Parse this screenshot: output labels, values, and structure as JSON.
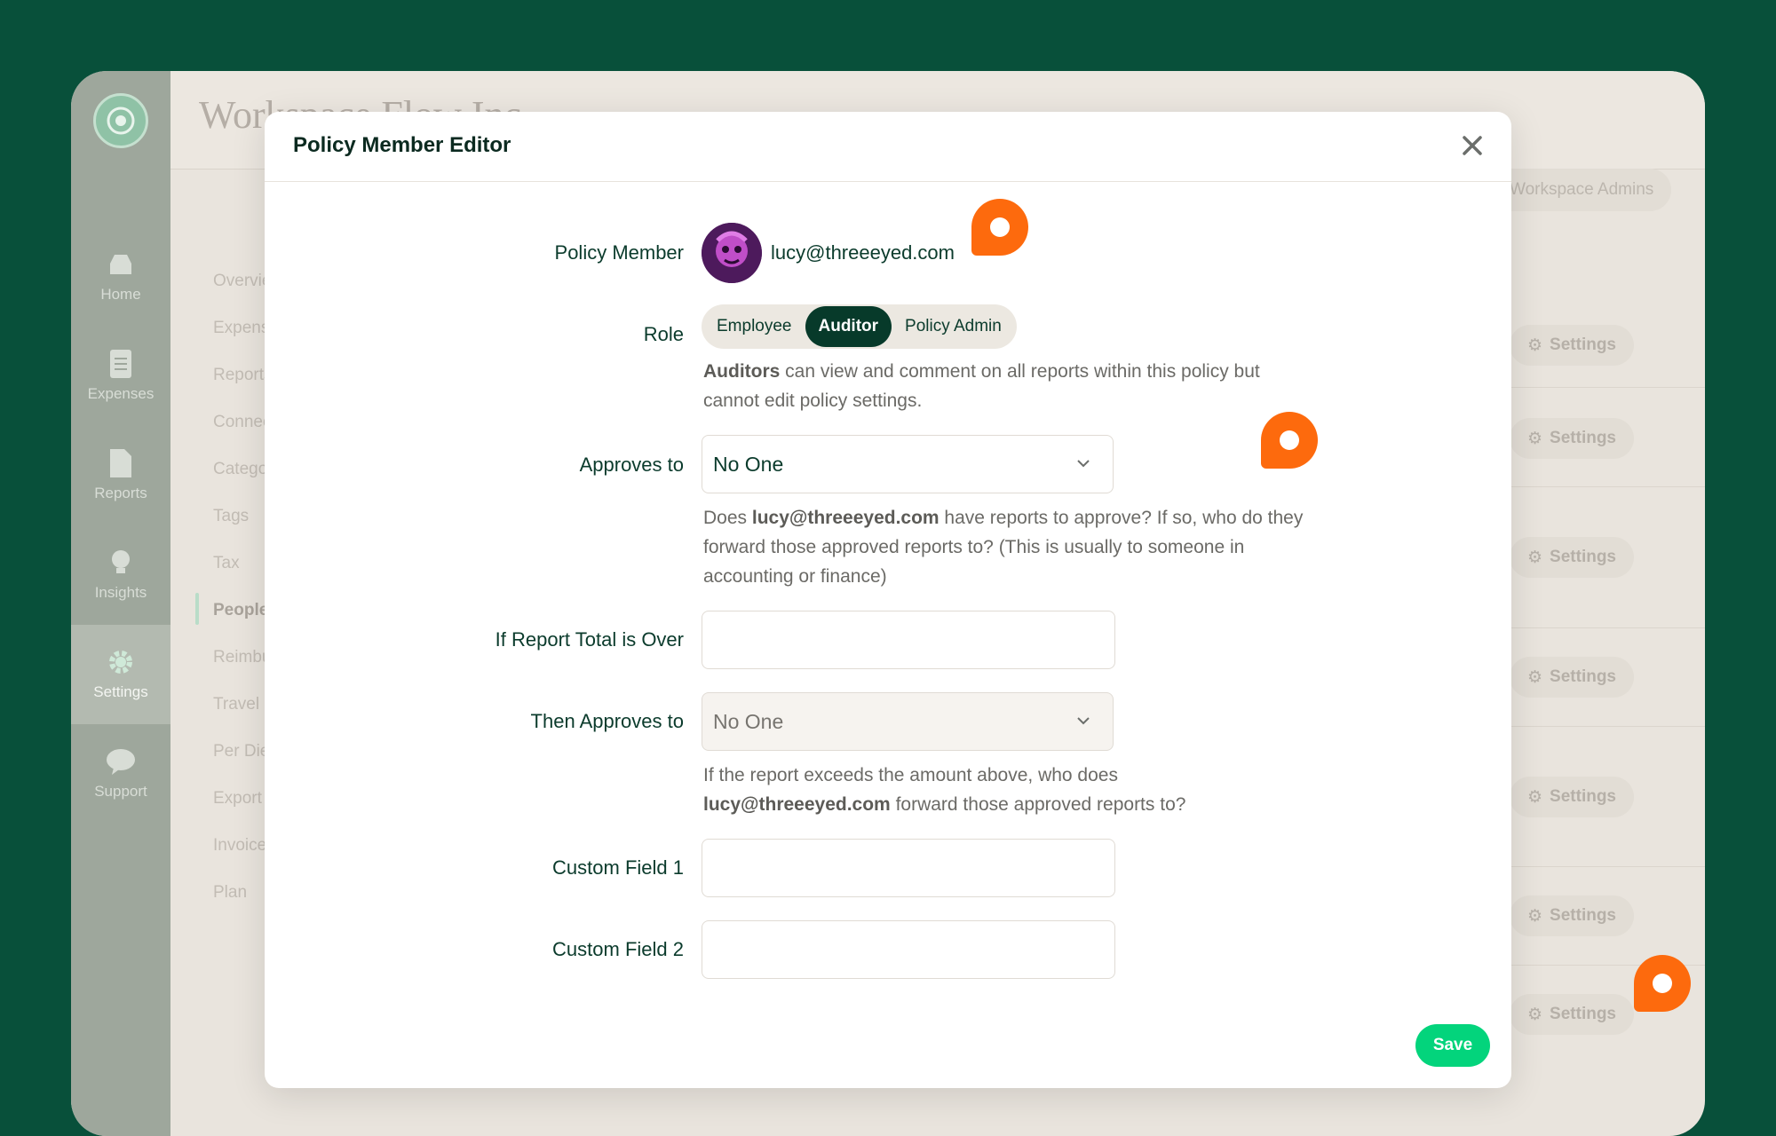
{
  "app": {
    "bg_title": "Workspace Flow Inc.",
    "rail": [
      {
        "label": "Home",
        "icon": "inbox-icon"
      },
      {
        "label": "Expenses",
        "icon": "receipt-icon"
      },
      {
        "label": "Reports",
        "icon": "document-icon"
      },
      {
        "label": "Insights",
        "icon": "lightbulb-icon"
      },
      {
        "label": "Settings",
        "icon": "gear-icon",
        "active": true
      },
      {
        "label": "Support",
        "icon": "chat-bubble-icon"
      }
    ],
    "subnav": [
      "Overview",
      "Expenses",
      "Reports",
      "Connections",
      "Categories",
      "Tags",
      "Tax",
      "People",
      "Reimbursement",
      "Travel",
      "Per Diem",
      "Export",
      "Invoices",
      "Plan"
    ],
    "admins_label": "Workspace Admins",
    "settings_label": "Settings"
  },
  "modal": {
    "title": "Policy Member Editor",
    "policy_member_label": "Policy Member",
    "member_email": "lucy@threeeyed.com",
    "role_label": "Role",
    "roles": [
      "Employee",
      "Auditor",
      "Policy Admin"
    ],
    "selected_role": "Auditor",
    "role_help": {
      "bold": "Auditors",
      "text": " can view and comment on all reports within this policy but cannot edit policy settings."
    },
    "approves_to_label": "Approves to",
    "approves_to_value": "No One",
    "approves_help": {
      "pre": "Does ",
      "email": "lucy@threeeyed.com",
      "post": " have reports to approve? If so, who do they forward those approved reports to? (This is usually to someone in accounting or finance)"
    },
    "report_total_label": "If Report Total is Over",
    "report_total_value": "",
    "then_approves_label": "Then Approves to",
    "then_approves_value": "No One",
    "then_help": {
      "pre": "If the report exceeds the amount above, who does ",
      "email": "lucy@threeeyed.com",
      "post": " forward those approved reports to?"
    },
    "custom1_label": "Custom Field 1",
    "custom1_value": "",
    "custom2_label": "Custom Field 2",
    "custom2_value": "",
    "save_label": "Save"
  },
  "colors": {
    "brand_green": "#03d47c",
    "dark_green": "#073a2a",
    "marker_orange": "#fd6a0d",
    "page_bg": "#08503a"
  }
}
